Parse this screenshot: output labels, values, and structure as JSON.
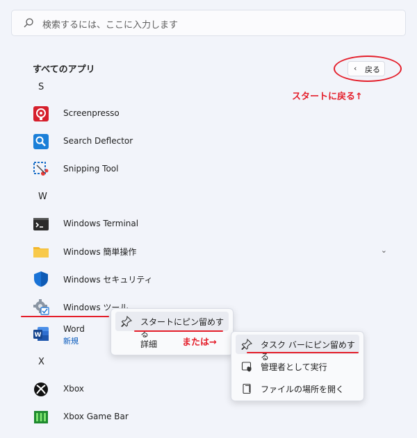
{
  "search": {
    "placeholder": "検索するには、ここに入力します"
  },
  "all_apps": {
    "title": "すべてのアプリ",
    "back_label": "戻る"
  },
  "annotations": {
    "back_to_start": "スタートに戻る↑",
    "or": "または→"
  },
  "letters": {
    "s": "S",
    "w": "W",
    "x": "X"
  },
  "apps": [
    {
      "name": "Screenpresso"
    },
    {
      "name": "Search Deflector"
    },
    {
      "name": "Snipping Tool"
    },
    {
      "name": "Windows Terminal"
    },
    {
      "name": "Windows 簡単操作"
    },
    {
      "name": "Windows セキュリティ"
    },
    {
      "name": "Windows ツール"
    },
    {
      "name": "Word",
      "sub": "新規"
    },
    {
      "name": "Xbox"
    },
    {
      "name": "Xbox Game Bar"
    }
  ],
  "context_menu": {
    "pin_start": "スタートにピン留めする",
    "more": "詳細"
  },
  "submenu": {
    "pin_taskbar": "タスク バーにピン留めする",
    "run_admin": "管理者として実行",
    "open_location": "ファイルの場所を開く"
  },
  "colors": {
    "annotation_red": "#e41e2a",
    "accent": "#0a5bbd"
  }
}
